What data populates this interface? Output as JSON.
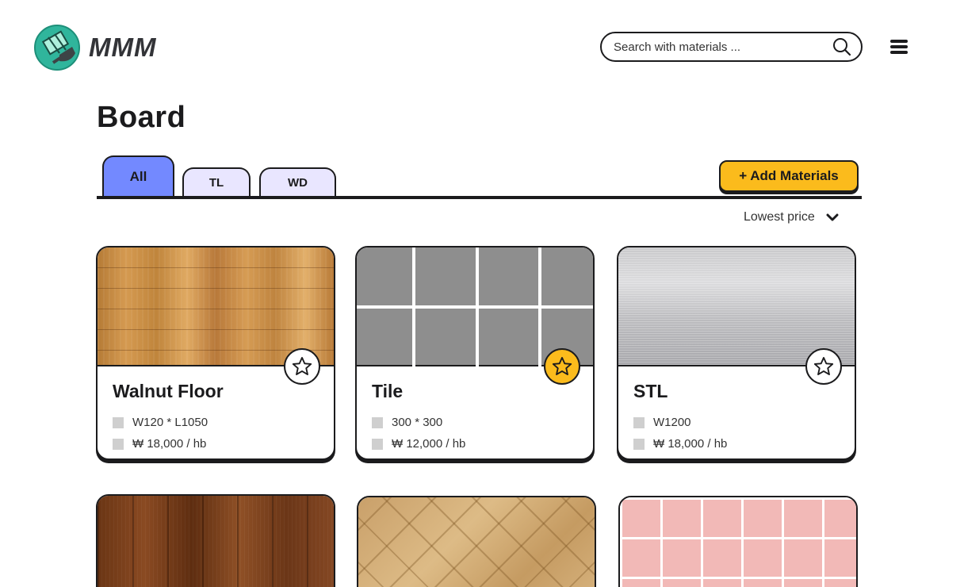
{
  "header": {
    "brand": "MMM",
    "search_placeholder": "Search with materials ...",
    "search_icon": "search-icon",
    "menu_icon": "hamburger-menu-icon"
  },
  "page": {
    "title": "Board"
  },
  "tabs": [
    {
      "label": "All",
      "active": true
    },
    {
      "label": "TL",
      "active": false
    },
    {
      "label": "WD",
      "active": false
    }
  ],
  "actions": {
    "add_materials": "+ Add Materials"
  },
  "sort": {
    "label": "Lowest price",
    "icon": "chevron-down-icon"
  },
  "cards": [
    {
      "title": "Walnut Floor",
      "spec": "W120 * L1050",
      "price": "₩ 18,000 / hb",
      "favorite": false
    },
    {
      "title": "Tile",
      "spec": "300 * 300",
      "price": "₩ 12,000 / hb",
      "favorite": true
    },
    {
      "title": "STL",
      "spec": "W1200",
      "price": "₩ 18,000 / hb",
      "favorite": false
    },
    {
      "title": "",
      "spec": "",
      "price": "",
      "favorite": false
    },
    {
      "title": "",
      "spec": "",
      "price": "",
      "favorite": false
    },
    {
      "title": "",
      "spec": "",
      "price": "",
      "favorite": false
    }
  ],
  "colors": {
    "accent_yellow": "#fbbb1c",
    "tab_active": "#7389ff",
    "tab_inactive": "#e9e6ff",
    "brand_green": "#30b59c",
    "ink": "#1b1b1d"
  }
}
